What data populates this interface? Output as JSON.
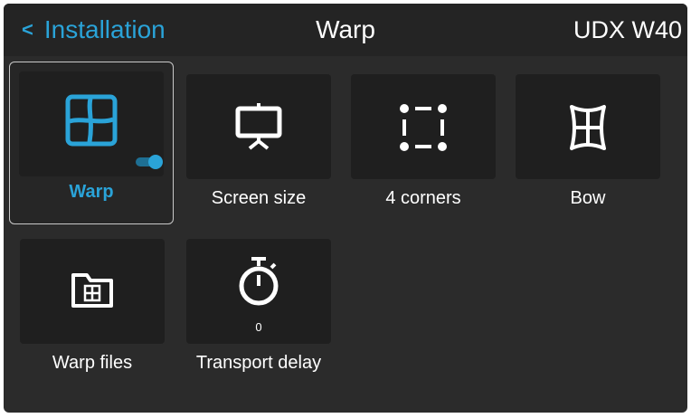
{
  "header": {
    "back_label": "Installation",
    "title": "Warp",
    "device": "UDX W40"
  },
  "tiles": [
    {
      "label": "Warp",
      "icon": "warp-grid-icon",
      "selected": true,
      "toggle": "on"
    },
    {
      "label": "Screen size",
      "icon": "projection-screen-icon"
    },
    {
      "label": "4 corners",
      "icon": "four-corners-icon"
    },
    {
      "label": "Bow",
      "icon": "bow-icon"
    },
    {
      "label": "Warp files",
      "icon": "warp-folder-icon"
    },
    {
      "label": "Transport delay",
      "icon": "stopwatch-icon",
      "value": "0"
    }
  ],
  "colors": {
    "accent": "#2aa3d8",
    "background": "#2b2b2b",
    "tile": "#1f1f1f",
    "text": "#ffffff"
  }
}
